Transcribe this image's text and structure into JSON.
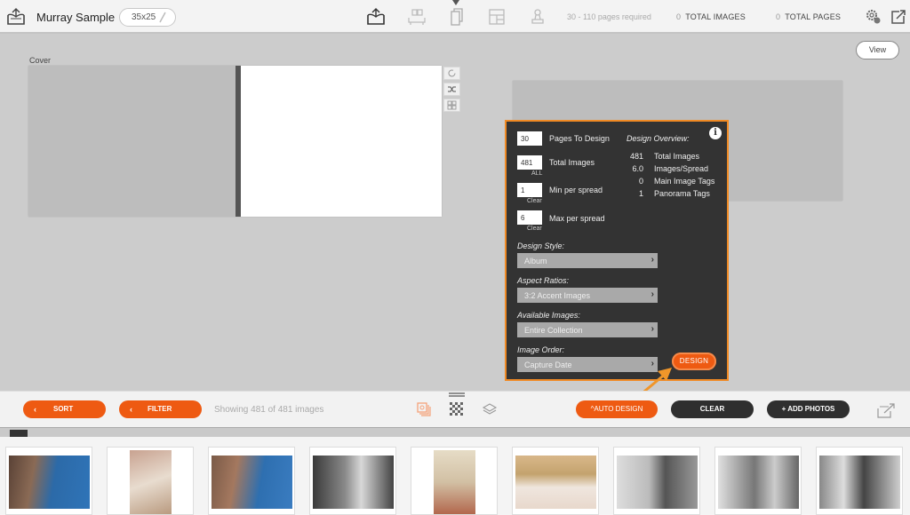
{
  "header": {
    "project_title": "Murray Sample",
    "album_size": "35x25",
    "pages_required": "30 - 110 pages required",
    "total_images_count": "0",
    "total_images_label": "TOTAL IMAGES",
    "total_pages_count": "0",
    "total_pages_label": "TOTAL PAGES",
    "nav_icons": [
      "album-design-icon",
      "spread-layout-icon",
      "pages-icon",
      "template-icon",
      "stamp-icon"
    ],
    "active_nav": "pages-icon"
  },
  "canvas": {
    "cover_label": "Cover",
    "view_button": "View",
    "side_tools": [
      "refresh-icon",
      "shuffle-icon",
      "grid-layout-icon"
    ]
  },
  "auto_design_panel": {
    "pages_to_design": {
      "value": "30",
      "label": "Pages To Design"
    },
    "total_images": {
      "value": "481",
      "label": "Total Images",
      "sub": "ALL"
    },
    "min_per_spread": {
      "value": "1",
      "label": "Min per spread",
      "sub": "Clear"
    },
    "max_per_spread": {
      "value": "6",
      "label": "Max per spread",
      "sub": "Clear"
    },
    "overview_title": "Design Overview:",
    "overview": [
      {
        "value": "481",
        "label": "Total Images"
      },
      {
        "value": "6.0",
        "label": "Images/Spread"
      },
      {
        "value": "0",
        "label": "Main Image Tags"
      },
      {
        "value": "1",
        "label": "Panorama Tags"
      }
    ],
    "design_style": {
      "label": "Design Style:",
      "value": "Album"
    },
    "aspect_ratios": {
      "label": "Aspect Ratios:",
      "value": "3:2 Accent Images"
    },
    "available_images": {
      "label": "Available Images:",
      "value": "Entire Collection"
    },
    "image_order": {
      "label": "Image Order:",
      "value": "Capture Date"
    },
    "design_button": "DESIGN"
  },
  "toolbar": {
    "sort_label": "SORT",
    "filter_label": "FILTER",
    "showing_text": "Showing 481 of 481 images",
    "auto_design_label": "^AUTO DESIGN",
    "clear_label": "CLEAR",
    "add_photos_label": "+ ADD PHOTOS"
  },
  "colors": {
    "accent_orange": "#ee5a12",
    "panel_border": "#f08a24",
    "panel_bg": "#333333",
    "dark_button": "#2f2f2f"
  },
  "filmstrip": {
    "thumbnails": [
      {
        "kind": "color",
        "orientation": "landscape"
      },
      {
        "kind": "color",
        "orientation": "portrait"
      },
      {
        "kind": "color",
        "orientation": "landscape"
      },
      {
        "kind": "bw",
        "orientation": "landscape"
      },
      {
        "kind": "color",
        "orientation": "portrait"
      },
      {
        "kind": "color",
        "orientation": "landscape"
      },
      {
        "kind": "bw",
        "orientation": "landscape"
      },
      {
        "kind": "bw",
        "orientation": "landscape"
      },
      {
        "kind": "bw",
        "orientation": "landscape"
      }
    ]
  }
}
